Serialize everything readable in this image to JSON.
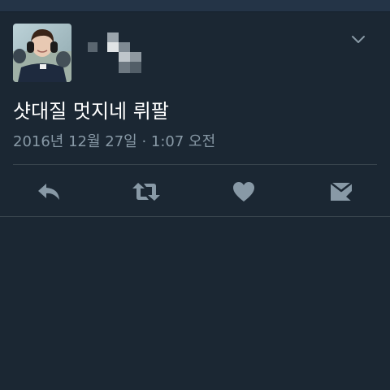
{
  "tweet": {
    "text": "샷대질 멋지네 뤼팔",
    "timestamp": "2016년 12월 27일 · 1:07 오전"
  },
  "icons": {
    "menu": "chevron-down-icon",
    "reply": "reply-icon",
    "retweet": "retweet-icon",
    "like": "heart-icon",
    "message": "direct-message-icon"
  },
  "colors": {
    "background": "#1b2733",
    "text": "#ffffff",
    "secondary_text": "#8899a6",
    "icon": "#8899a6",
    "divider": "#38444d"
  }
}
